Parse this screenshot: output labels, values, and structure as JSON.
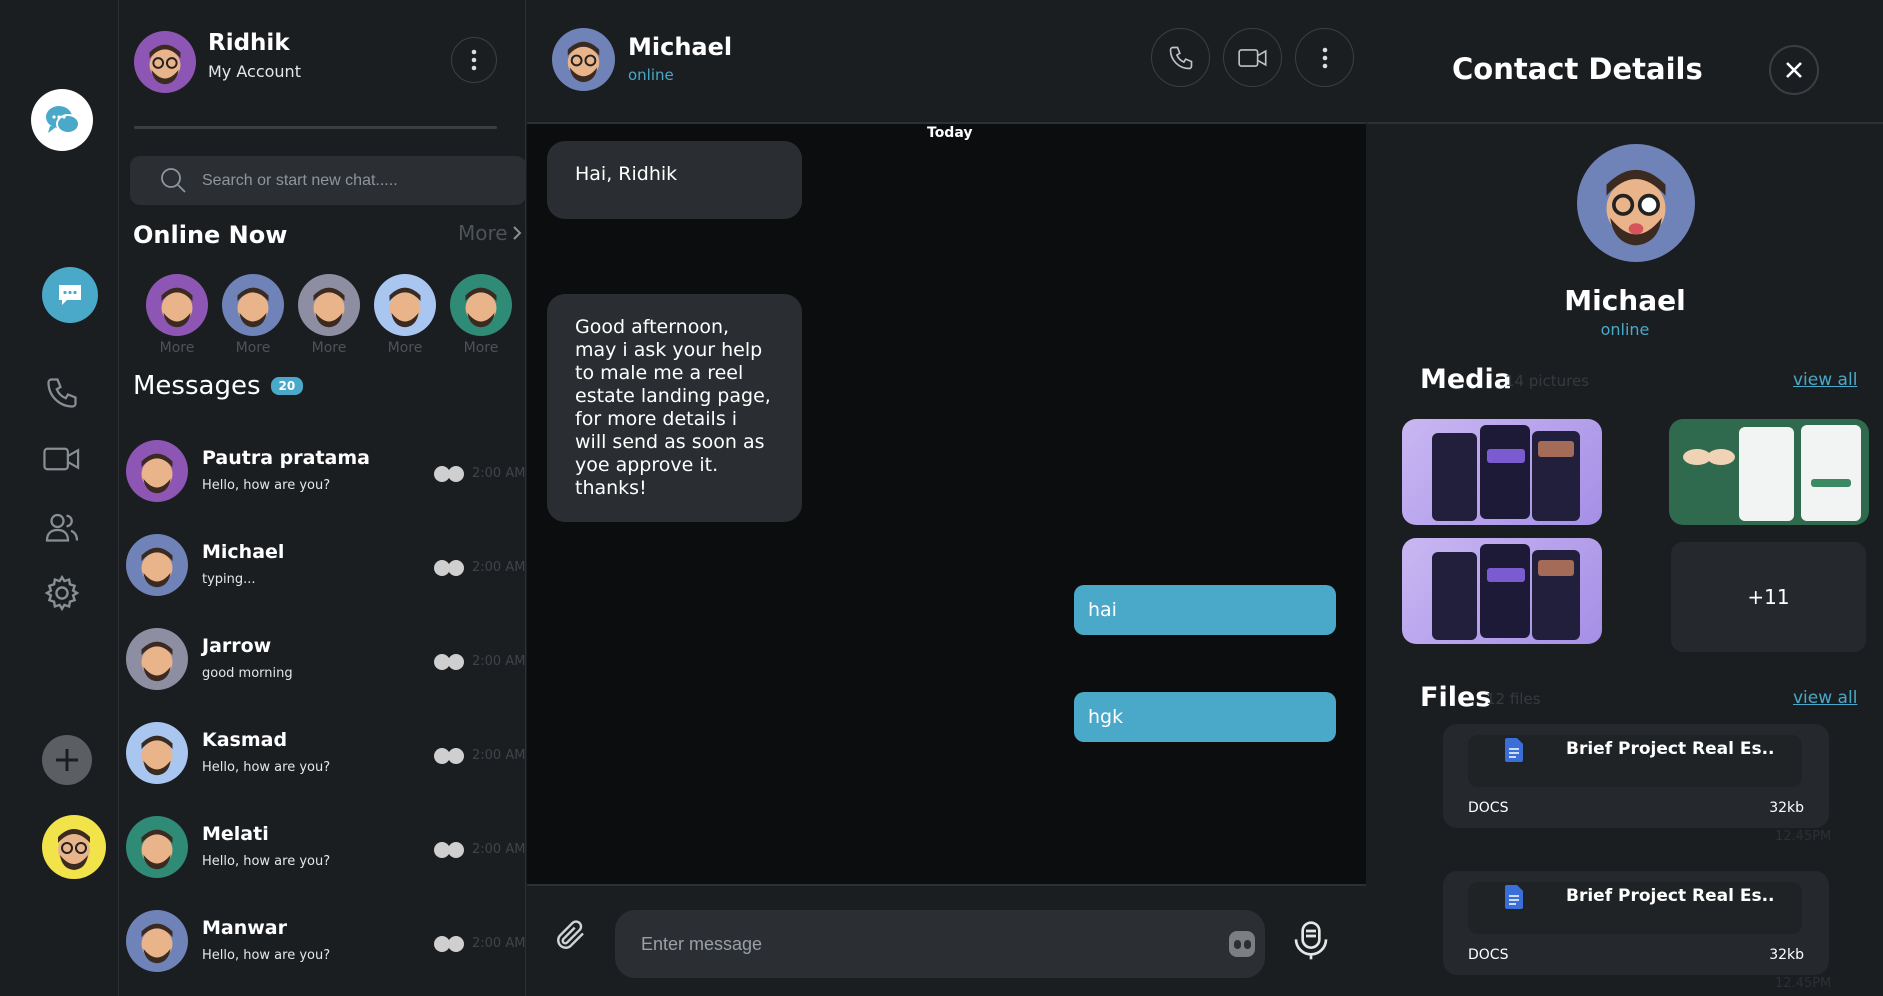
{
  "account": {
    "name": "Ridhik",
    "subtitle": "My Account"
  },
  "search": {
    "placeholder": "Search or start new chat....."
  },
  "online": {
    "title": "Online Now",
    "more_label": "More",
    "items": [
      {
        "label": "More",
        "color": "#8e56b4"
      },
      {
        "label": "More",
        "color": "#6f83b8"
      },
      {
        "label": "More",
        "color": "#8e8ea3"
      },
      {
        "label": "More",
        "color": "#a9c6f0"
      },
      {
        "label": "More",
        "color": "#2f8a76"
      }
    ]
  },
  "messages": {
    "title": "Messages",
    "badge": "20",
    "conversations": [
      {
        "name": "Pautra pratama",
        "preview": "Hello, how are you?",
        "time": "2:00 AM",
        "color": "#8e56b4"
      },
      {
        "name": "Michael",
        "preview": "typing...",
        "time": "2:00 AM",
        "color": "#6f83b8"
      },
      {
        "name": "Jarrow",
        "preview": "good morning",
        "time": "2:00 AM",
        "color": "#8e8ea3"
      },
      {
        "name": "Kasmad",
        "preview": "Hello, how are you?",
        "time": "2:00 AM",
        "color": "#a9c6f0"
      },
      {
        "name": "Melati",
        "preview": "Hello, how are you?",
        "time": "2:00 AM",
        "color": "#2f8a76"
      },
      {
        "name": "Manwar",
        "preview": "Hello, how are you?",
        "time": "2:00 AM",
        "color": "#6f83b8"
      }
    ]
  },
  "chat": {
    "contact_name": "Michael",
    "contact_status": "online",
    "day_label": "Today",
    "incoming": [
      "Hai, Ridhik",
      "Good afternoon, may i ask your help to male me a reel estate landing page, for more details i will send as soon as yoe approve it. thanks!"
    ],
    "outgoing": [
      "hai",
      "hgk"
    ],
    "composer_placeholder": "Enter message"
  },
  "details": {
    "title": "Contact Details",
    "name": "Michael",
    "status": "online",
    "media_title": "Media",
    "media_count": "14 pictures",
    "media_more": "+11",
    "view_all": "view all",
    "files_title": "Files",
    "files_count": "12 files",
    "files": [
      {
        "name": "Brief Project Real Es..",
        "type": "DOCS",
        "size": "32kb",
        "time": "12.45PM"
      },
      {
        "name": "Brief Project Real Es..",
        "type": "DOCS",
        "size": "32kb",
        "time": "12.45PM"
      }
    ]
  },
  "colors": {
    "accent": "#4aa8c9",
    "background": "#1b1e21",
    "chat_background": "#0b0d0f"
  }
}
